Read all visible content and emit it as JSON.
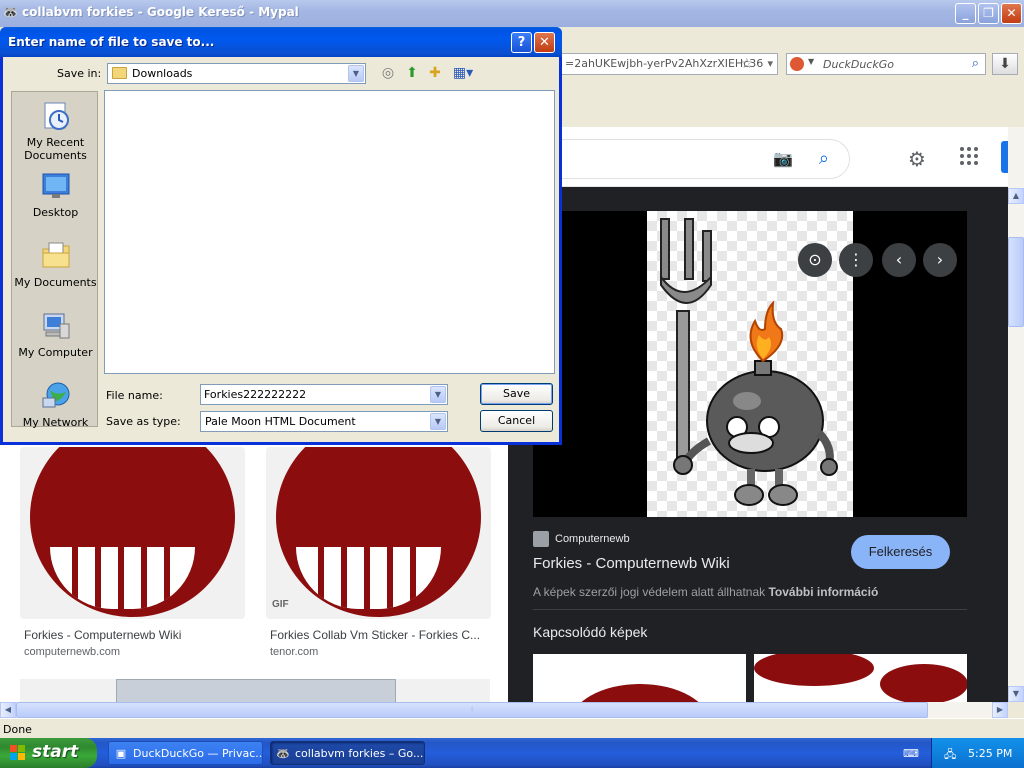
{
  "browser": {
    "title": "collabvm forkies - Google Kereső - Mypal",
    "url_fragment": "=2ahUKEwjbh-yerPv2AhXzrXIEHc36",
    "search_placeholder": "DuckDuckGo",
    "status": "Done"
  },
  "results": [
    {
      "caption": "Forkies - Computernewb Wiki",
      "source": "computernewb.com",
      "badge": ""
    },
    {
      "caption": "Forkies Collab Vm Sticker - Forkies C...",
      "source": "tenor.com",
      "badge": "GIF"
    }
  ],
  "preview": {
    "site": "Computernewb",
    "title": "Forkies - Computernewb Wiki",
    "visit_label": "Felkeresés",
    "copyright": "A képek szerzői jogi védelem alatt állhatnak",
    "more_info": "További információ",
    "related_heading": "Kapcsolódó képek"
  },
  "dialog": {
    "title": "Enter name of file to save to...",
    "save_in_label": "Save in:",
    "save_in_value": "Downloads",
    "places": [
      "My Recent Documents",
      "Desktop",
      "My Documents",
      "My Computer",
      "My Network"
    ],
    "file_name_label": "File name:",
    "file_name_value": "Forkies222222222",
    "save_as_type_label": "Save as type:",
    "save_as_type_value": "Pale Moon HTML Document",
    "save_label": "Save",
    "cancel_label": "Cancel"
  },
  "taskbar": {
    "start_label": "start",
    "tasks": [
      "DuckDuckGo — Privac...",
      "collabvm forkies – Go..."
    ],
    "clock": "5:25 PM"
  },
  "colors": {
    "xp_title_blue": "#0054e3",
    "start_green": "#3aa83a",
    "forkies_red": "#8b0d0d",
    "google_blue": "#1a73e8",
    "preview_bg": "#202124"
  }
}
